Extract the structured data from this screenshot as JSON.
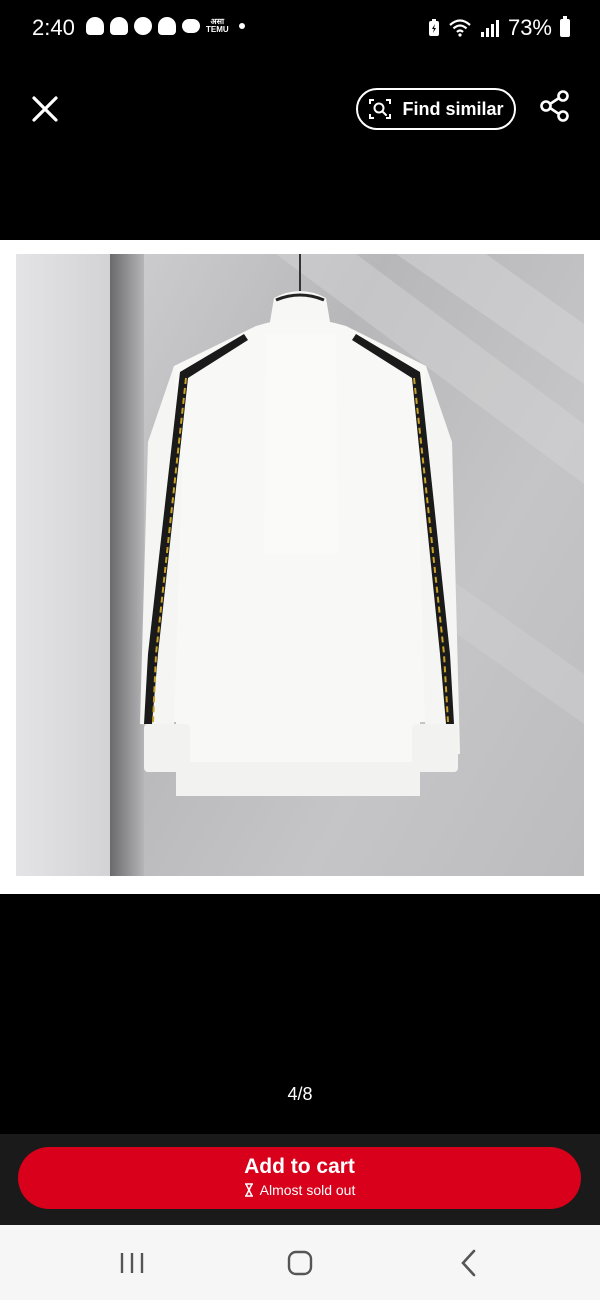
{
  "status_bar": {
    "time": "2:40",
    "temu_label_top": "असा",
    "temu_label_bottom": "TEMU",
    "battery": "73%"
  },
  "toolbar": {
    "find_similar_label": "Find similar"
  },
  "gallery": {
    "counter": "4/8"
  },
  "cart": {
    "add_label": "Add to cart",
    "stock_note": "Almost sold out",
    "accent_color": "#d8001a"
  },
  "icons": {
    "close": "close-icon",
    "find_similar": "scan-icon",
    "share": "share-icon",
    "hourglass": "hourglass-icon",
    "recents": "recents-icon",
    "home": "home-icon",
    "back": "back-icon"
  }
}
